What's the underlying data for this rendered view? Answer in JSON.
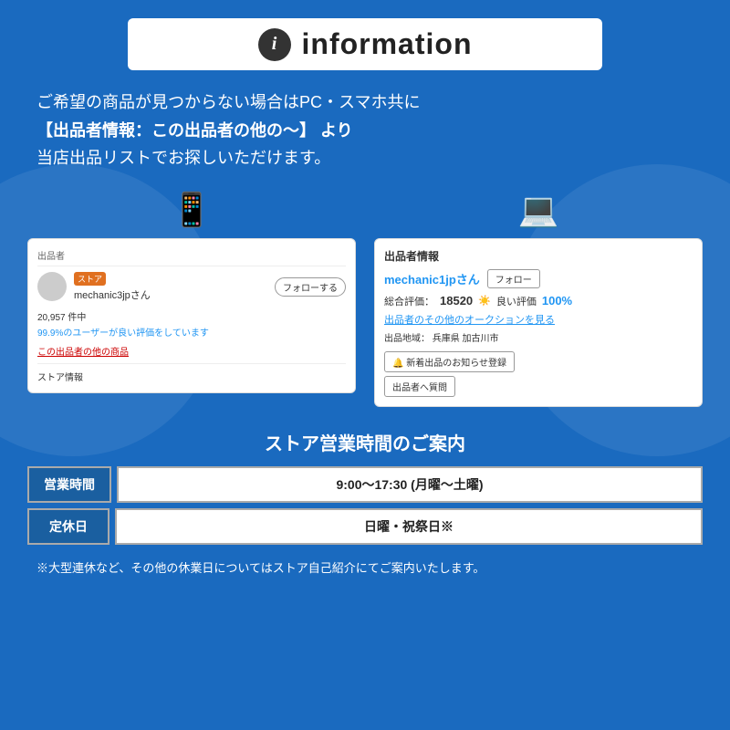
{
  "header": {
    "icon_label": "i",
    "title": "information"
  },
  "description": {
    "line1": "ご希望の商品が見つからない場合はPC・スマホ共に",
    "line2": "【出品者情報：この出品者の他の〜】 より",
    "line3": "当店出品リストでお探しいただけます。"
  },
  "mobile_screenshot": {
    "seller_section_label": "出品者",
    "store_badge": "ストア",
    "seller_name": "mechanic3jpさん",
    "follow_button": "フォローする",
    "count": "20,957 件中",
    "rating_text": "99.9%のユーザーが良い評価をしています",
    "other_items_link": "この出品者の他の商品",
    "store_info_link": "ストア情報"
  },
  "desktop_screenshot": {
    "section_label": "出品者情報",
    "seller_name": "mechanic1jpさん",
    "follow_button": "フォロー",
    "total_rating_label": "総合評価：",
    "total_rating_value": "18520",
    "good_rating_label": "良い評価",
    "good_rating_percent": "100%",
    "auction_link": "出品者のその他のオークションを見る",
    "location_label": "出品地域：",
    "location_value": "兵庫県 加古川市",
    "notification_btn": "🔔 新着出品のお知らせ登録",
    "question_btn": "出品者へ質問"
  },
  "store_hours": {
    "title": "ストア営業時間のご案内",
    "rows": [
      {
        "label": "営業時間",
        "value": "9:00〜17:30 (月曜〜土曜)"
      },
      {
        "label": "定休日",
        "value": "日曜・祝祭日※"
      }
    ],
    "note": "※大型連休など、その他の休業日についてはストア自己紹介にてご案内いたします。"
  }
}
